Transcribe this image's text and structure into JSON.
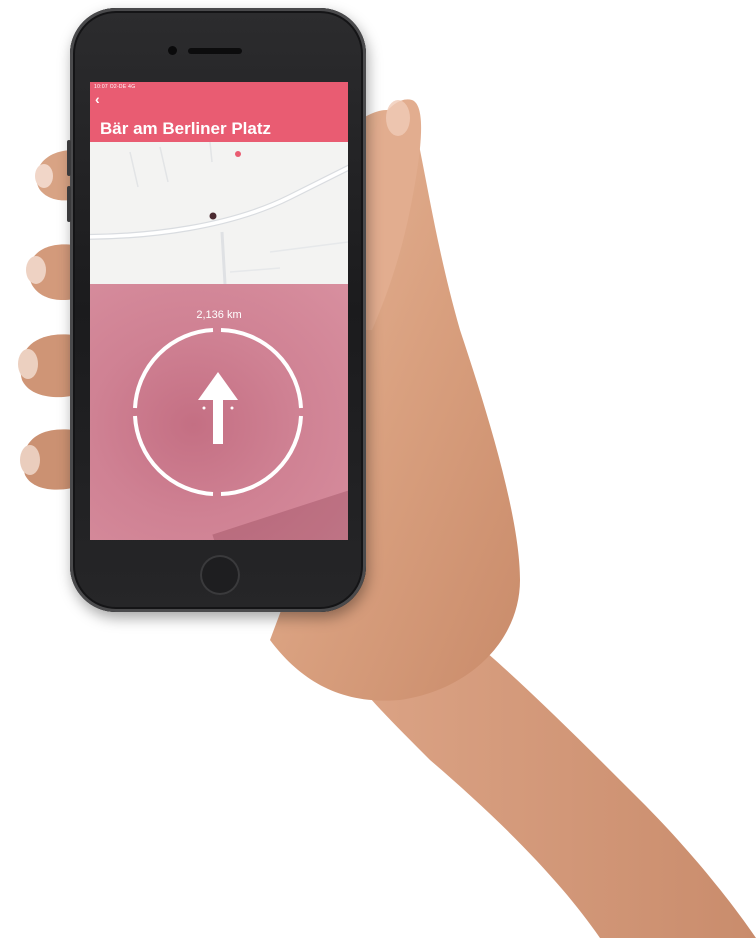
{
  "app": {
    "status_bar": "10:07   O2-DE 4G",
    "title": "Bär am Berliner Platz",
    "back_icon": "chevron-left-icon",
    "distance": "2,136 km",
    "compass_icon": "arrow-up-icon"
  },
  "colors": {
    "header": "#e95c72",
    "compass_bg": "#cf8193",
    "text": "#ffffff"
  }
}
